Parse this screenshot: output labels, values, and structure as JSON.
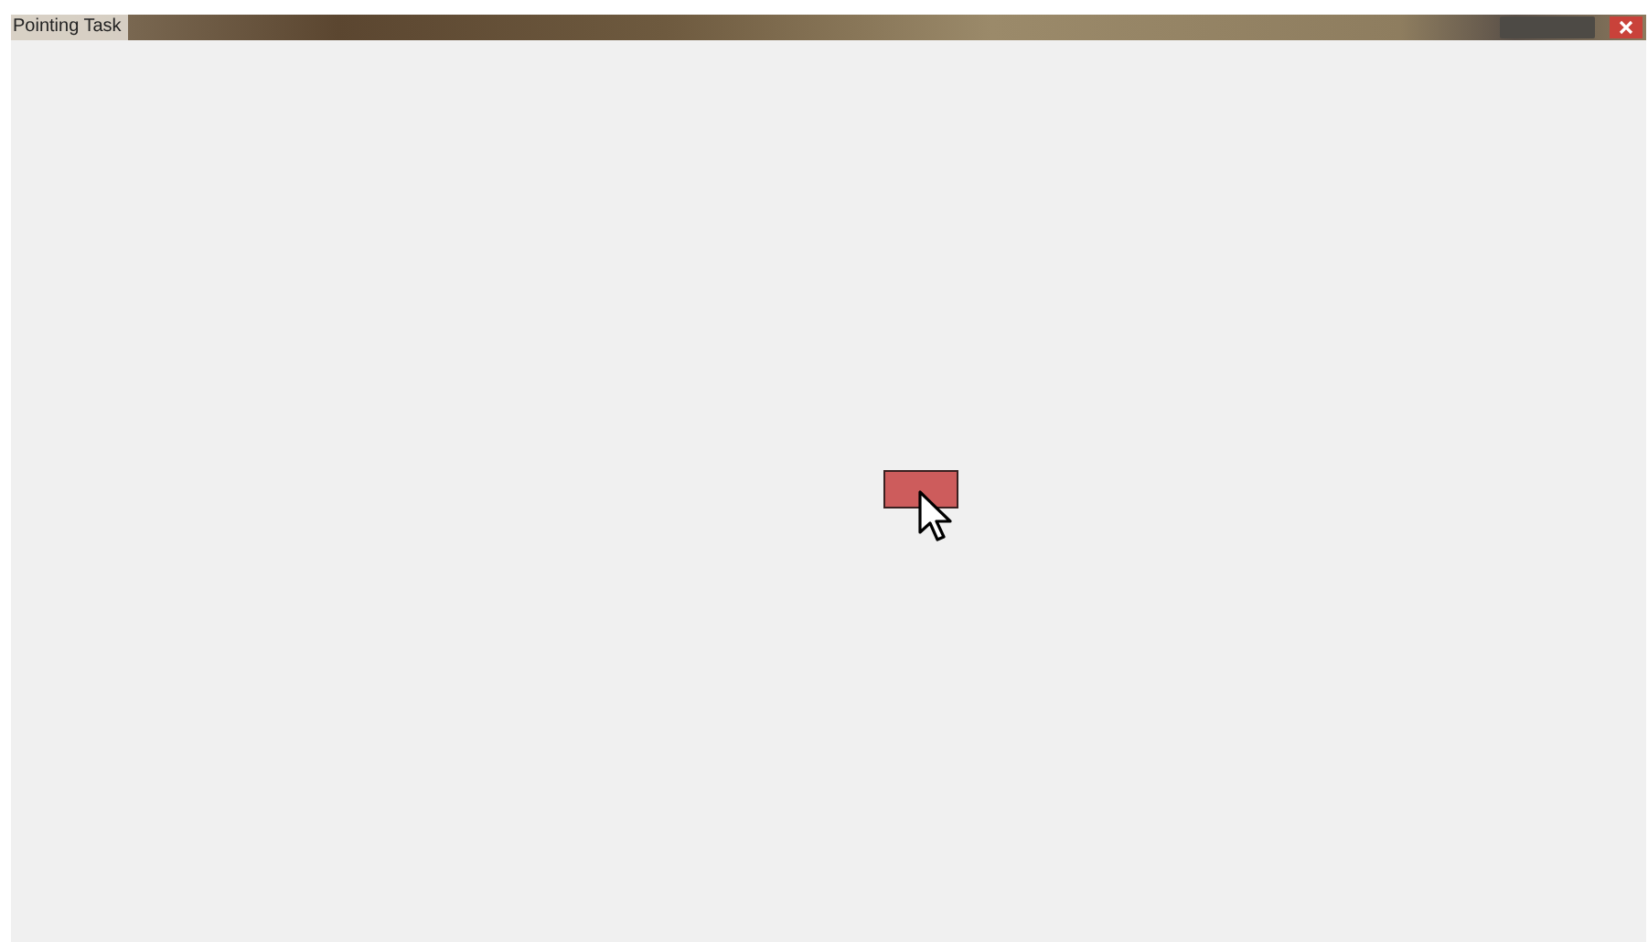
{
  "window": {
    "title": "Pointing Task"
  }
}
